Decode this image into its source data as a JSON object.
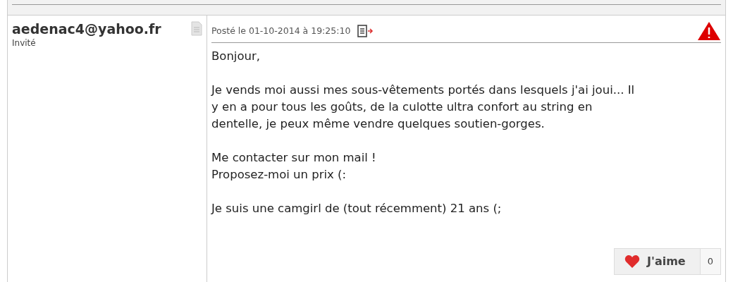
{
  "post": {
    "author": "aedenac4@yahoo.fr",
    "role": "Invité",
    "posted": "Posté le 01-10-2014 à 19:25:10",
    "paragraphs": [
      [
        "Bonjour,"
      ],
      [
        "Je vends moi aussi mes sous-vêtements portés dans lesquels j'ai joui... Il",
        "y en a pour tous les goûts, de la culotte ultra confort au string en",
        "dentelle, je peux même vendre quelques soutien-gorges."
      ],
      [
        "Me contacter sur mon mail !",
        "Proposez-moi un prix (:"
      ],
      [
        "Je suis une camgirl de (tout récemment) 21 ans (;"
      ]
    ],
    "like_label": "J'aime",
    "like_count": "0"
  }
}
